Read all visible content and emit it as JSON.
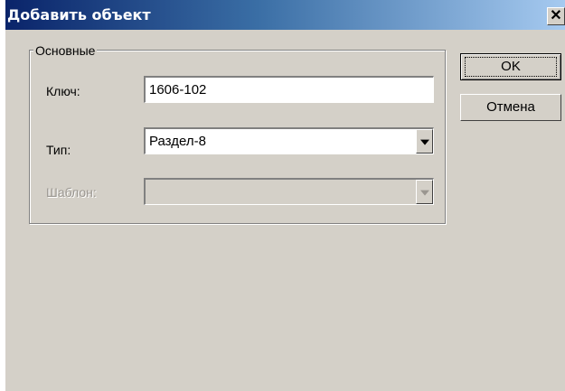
{
  "window": {
    "title": "Добавить объект",
    "close_label": "✕"
  },
  "group": {
    "legend": "Основные"
  },
  "fields": {
    "key_label": "Ключ:",
    "key_value": "1606-102",
    "type_label": "Тип:",
    "type_value": "Раздел-8",
    "template_label": "Шаблон:",
    "template_value": ""
  },
  "buttons": {
    "ok_label": "OK",
    "cancel_label": "Отмена"
  }
}
